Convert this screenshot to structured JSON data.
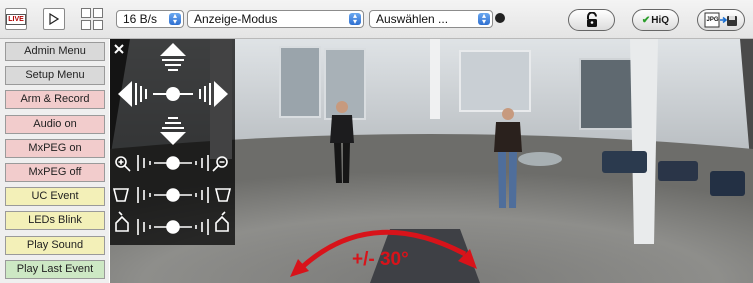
{
  "toolbar": {
    "live_label": "LIVE",
    "frame_rate": "16 B/s",
    "display_mode": "Anzeige-Modus",
    "select": "Auswählen ...",
    "hiq_label": "HiQ",
    "jpg_label": "JPG"
  },
  "sidebar": {
    "buttons": [
      {
        "label": "Admin Menu",
        "color": "#d9d9d9"
      },
      {
        "label": "Setup Menu",
        "color": "#d9d9d9"
      },
      {
        "label": "Arm & Record",
        "color": "#f2cccc"
      },
      {
        "label": "Audio on",
        "color": "#f2cccc"
      },
      {
        "label": "MxPEG on",
        "color": "#f2cccc"
      },
      {
        "label": "MxPEG off",
        "color": "#f2cccc"
      },
      {
        "label": "UC Event",
        "color": "#f3f0b8"
      },
      {
        "label": "LEDs Blink",
        "color": "#f3f0b8"
      },
      {
        "label": "Play Sound",
        "color": "#f3f0b8"
      },
      {
        "label": "Play Last Event",
        "color": "#cde8c4"
      }
    ]
  },
  "overlay": {
    "caption": "+/- 30°",
    "caption_color": "#d8131a"
  },
  "icons": [
    "live-icon",
    "play-icon",
    "grid-icon",
    "lock-icon",
    "camera-icon",
    "close-icon",
    "zoom-in-icon",
    "zoom-out-icon"
  ]
}
